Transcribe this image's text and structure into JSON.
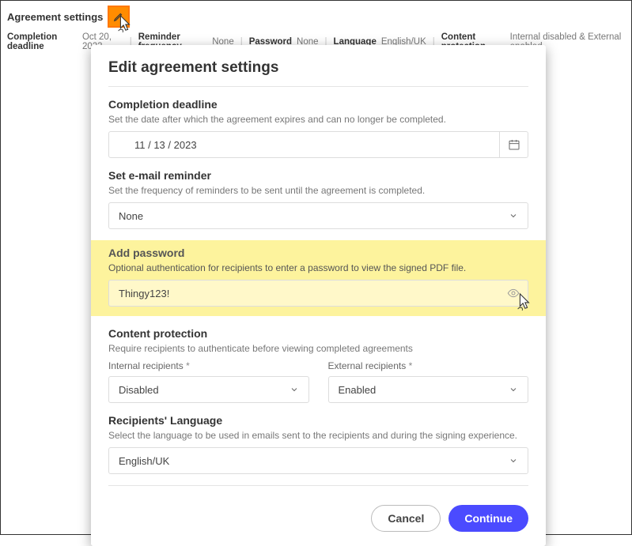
{
  "topbar": {
    "title": "Agreement settings",
    "completion_deadline_label": "Completion deadline",
    "completion_deadline_value": "Oct 20, 2023",
    "reminder_label": "Reminder frequency",
    "reminder_value": "None",
    "password_label": "Password",
    "password_value": "None",
    "language_label": "Language",
    "language_value": "English/UK",
    "content_protection_label": "Content protection",
    "content_protection_value": "Internal disabled & External enabled"
  },
  "dialog": {
    "title": "Edit agreement settings",
    "deadline": {
      "title": "Completion deadline",
      "desc": "Set the date after which the agreement expires and can no longer be completed.",
      "value": "11 /  13 /  2023"
    },
    "reminder": {
      "title": "Set e-mail reminder",
      "desc": "Set the frequency of reminders to be sent until the agreement is completed.",
      "value": "None"
    },
    "password": {
      "title": "Add password",
      "desc": "Optional authentication for recipients to enter a password to view the signed PDF file.",
      "value": "Thingy123!"
    },
    "content_protection": {
      "title": "Content protection",
      "desc": "Require recipients to authenticate before viewing completed agreements",
      "internal_label": "Internal recipients",
      "internal_value": "Disabled",
      "external_label": "External recipients",
      "external_value": "Enabled"
    },
    "language": {
      "title": "Recipients' Language",
      "desc": "Select the language to be used in emails sent to the recipients and during the signing experience.",
      "value": "English/UK"
    },
    "cancel_label": "Cancel",
    "continue_label": "Continue"
  }
}
